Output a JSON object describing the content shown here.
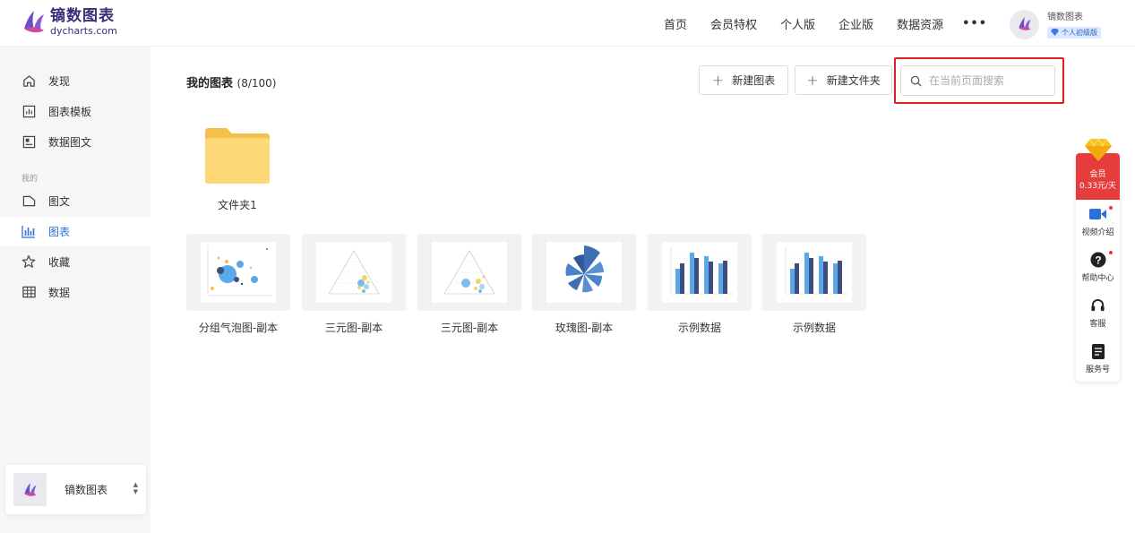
{
  "brand": {
    "name": "镝数图表",
    "domain": "dycharts.com"
  },
  "topnav": [
    "首页",
    "会员特权",
    "个人版",
    "企业版",
    "数据资源"
  ],
  "more_label": "•••",
  "user": {
    "name": "镝数图表",
    "badge": "个人初级版"
  },
  "sidebar": {
    "items": [
      {
        "label": "发现",
        "icon": "home-icon"
      },
      {
        "label": "图表模板",
        "icon": "chart-template-icon"
      },
      {
        "label": "数据图文",
        "icon": "data-article-icon"
      },
      {
        "label": "图文",
        "icon": "article-icon"
      },
      {
        "label": "图表",
        "icon": "bar-chart-icon"
      },
      {
        "label": "收藏",
        "icon": "star-icon"
      },
      {
        "label": "数据",
        "icon": "table-icon"
      }
    ],
    "group_label": "我的",
    "active": "图表",
    "workspace": "镝数图表"
  },
  "main": {
    "title": "我的图表",
    "count": "(8/100)",
    "new_chart": "新建图表",
    "new_folder": "新建文件夹",
    "search_placeholder": "在当前页面搜索",
    "folder": "文件夹1",
    "charts": [
      "分组气泡图-副本",
      "三元图-副本",
      "三元图-副本",
      "玫瑰图-副本",
      "示例数据",
      "示例数据"
    ]
  },
  "right_panel": {
    "vip_line1": "会员",
    "vip_line2": "0.33元/天",
    "items": [
      "视频介绍",
      "帮助中心",
      "客服",
      "服务号"
    ]
  },
  "colors": {
    "accent": "#2e6fd8",
    "brand": "#3a2d7a",
    "highlight": "#e0201f",
    "vip": "#e53c3c"
  }
}
